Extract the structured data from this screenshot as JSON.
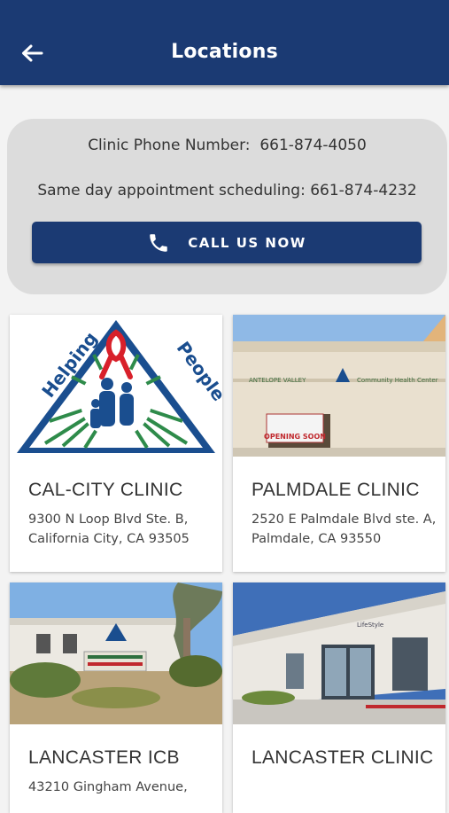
{
  "header": {
    "title": "Locations",
    "back_icon": "arrow-left-icon"
  },
  "info": {
    "clinic_phone_label": "Clinic Phone Number:",
    "clinic_phone": "661-874-4050",
    "same_day_label": "Same day appointment scheduling:",
    "same_day_phone": "661-874-4232",
    "call_button_label": "CALL US NOW",
    "call_icon": "phone-icon"
  },
  "locations": [
    {
      "name": "CAL-CITY CLINIC",
      "address": "9300 N Loop Blvd Ste. B, California City, CA 93505",
      "logo_text_left": "Helping",
      "logo_text_right": "People"
    },
    {
      "name": "PALMDALE CLINIC",
      "address": "2520 E Palmdale Blvd ste. A, Palmdale, CA 93550",
      "sign_text": "OPENING SOON"
    },
    {
      "name": "LANCASTER ICB",
      "address": "43210 Gingham Avenue,"
    },
    {
      "name": "LANCASTER CLINIC",
      "address": ""
    }
  ],
  "colors": {
    "primary": "#1b3a73",
    "card_bg": "#dcdcdc",
    "background": "#f3f3f3"
  }
}
